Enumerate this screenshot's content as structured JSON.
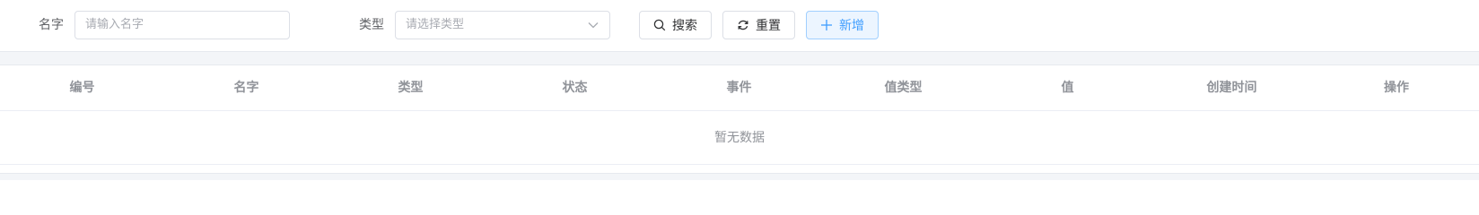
{
  "filters": {
    "name_label": "名字",
    "name_placeholder": "请输入名字",
    "type_label": "类型",
    "type_placeholder": "请选择类型"
  },
  "buttons": {
    "search": "搜索",
    "reset": "重置",
    "add": "新增"
  },
  "colors": {
    "primary": "#409eff",
    "primary_bg": "#ecf5ff",
    "header_text": "#909399",
    "border": "#dcdfe6"
  },
  "table": {
    "columns": [
      "编号",
      "名字",
      "类型",
      "状态",
      "事件",
      "值类型",
      "值",
      "创建时间",
      "操作"
    ],
    "empty_text": "暂无数据"
  }
}
